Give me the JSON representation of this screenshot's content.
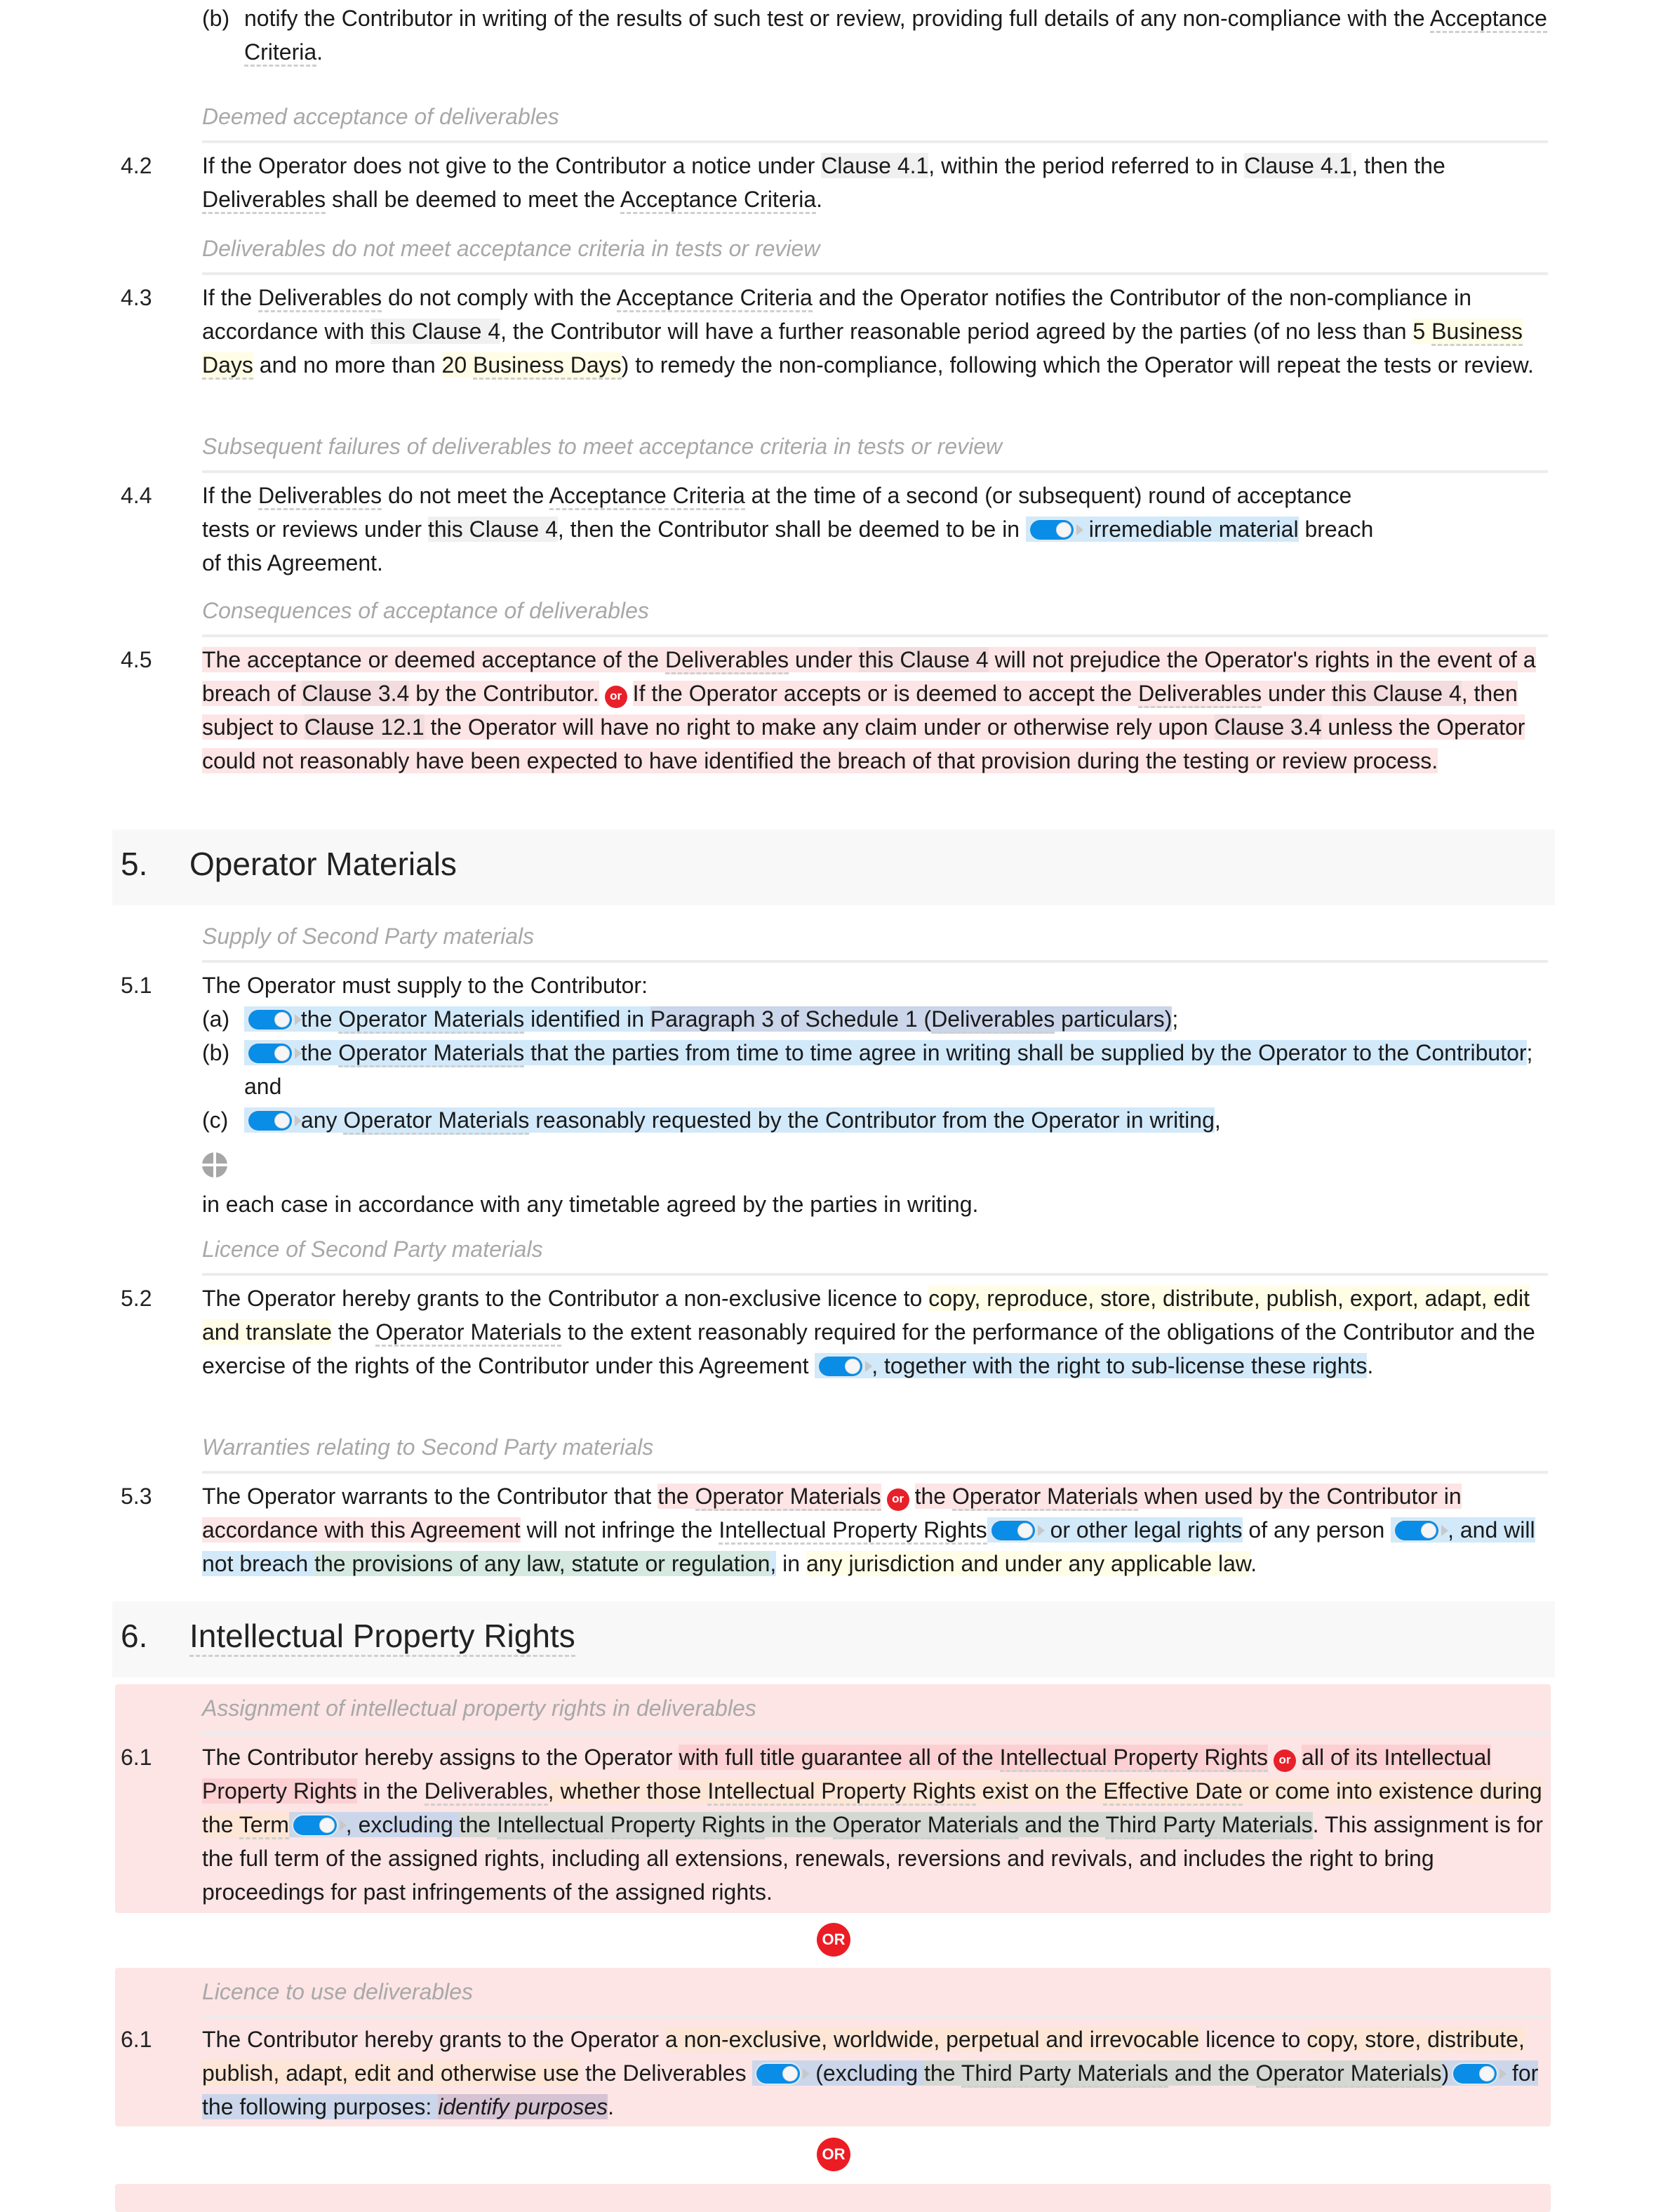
{
  "document": {
    "para_4_1_b": {
      "label": "(b)",
      "segments": [
        {
          "t": "notify the Contributor in writing of the results of such test or review, providing full details of any non-compliance with the "
        },
        {
          "t": "Acceptance Criteria",
          "k": "dterm"
        },
        {
          "t": "."
        }
      ]
    },
    "caption_4_2": "Deemed acceptance of deliverables",
    "para_4_2": {
      "num": "4.2",
      "segments": [
        {
          "t": "If the Operator does not give to the Contributor a notice under "
        },
        {
          "t": "Clause 4.1",
          "k": "cref"
        },
        {
          "t": ", within the period referred to in "
        },
        {
          "t": "Clause 4.1",
          "k": "cref"
        },
        {
          "t": ", then the "
        },
        {
          "t": "Deliverables",
          "k": "dterm"
        },
        {
          "t": " shall be deemed to meet the "
        },
        {
          "t": "Acceptance Criteria",
          "k": "dterm"
        },
        {
          "t": "."
        }
      ]
    },
    "caption_4_3": "Deliverables do not meet acceptance criteria in tests or review",
    "para_4_3": {
      "num": "4.3",
      "segments": [
        {
          "t": "If the "
        },
        {
          "t": "Deliverables",
          "k": "dterm"
        },
        {
          "t": " do not comply with the "
        },
        {
          "t": "Acceptance Criteria",
          "k": "dterm"
        },
        {
          "t": " and the Operator notifies the Contributor of the non-compliance in accordance with "
        },
        {
          "t": "this Clause 4",
          "k": "cref"
        },
        {
          "t": ", the Contributor will have a further reasonable period agreed by the parties (of no less than "
        },
        {
          "t": "5 ",
          "k": "hl-yellow"
        },
        {
          "t": "Business Days",
          "k": "hl-yellow dterm"
        },
        {
          "t": " and no more than "
        },
        {
          "t": "20 ",
          "k": "hl-yellow"
        },
        {
          "t": "Business Days",
          "k": "hl-yellow dterm"
        },
        {
          "t": ") to remedy the non-compliance, following which the Operator will repeat the tests or review."
        }
      ]
    },
    "caption_4_4": "Subsequent failures of deliverables to meet acceptance criteria in tests or review",
    "para_4_4": {
      "num": "4.4",
      "segments": [
        {
          "t": "If the "
        },
        {
          "t": "Deliverables",
          "k": "dterm"
        },
        {
          "t": " do not meet the "
        },
        {
          "t": "Acceptance Criteria",
          "k": "dterm"
        },
        {
          "t": " at the time of a second (or subsequent) round of acceptance tests or reviews under "
        },
        {
          "t": "this Clause 4",
          "k": "cref"
        },
        {
          "t": ", then the Contributor shall be deemed to be in "
        },
        {
          "toggle": true,
          "k": "hl-blue"
        },
        {
          "t": " irremediable material",
          "k": "hl-blue"
        },
        {
          "t": " breach of this Agreement."
        }
      ]
    },
    "caption_4_5": "Consequences of acceptance of deliverables",
    "para_4_5": {
      "num": "4.5",
      "segments": [
        {
          "t": "The acceptance or deemed acceptance of the ",
          "k": "hl-pink"
        },
        {
          "t": "Deliverables",
          "k": "hl-pink dterm"
        },
        {
          "t": " under ",
          "k": "hl-pink"
        },
        {
          "t": "this Clause 4",
          "k": "hl-pinkcref"
        },
        {
          "t": " will not prejudice the Operator's rights in the event of a breach of ",
          "k": "hl-pink"
        },
        {
          "t": "Clause 3.4",
          "k": "hl-pinkcref"
        },
        {
          "t": " by the Contributor.",
          "k": "hl-pink"
        },
        {
          "or": "or"
        },
        {
          "t": "If the Operator accepts or is deemed to accept the ",
          "k": "hl-pink"
        },
        {
          "t": "Deliverables",
          "k": "hl-pink dterm"
        },
        {
          "t": " under ",
          "k": "hl-pink"
        },
        {
          "t": "this Clause 4",
          "k": "hl-pinkcref"
        },
        {
          "t": ", then subject to ",
          "k": "hl-pink"
        },
        {
          "t": "Clause 12.1",
          "k": "hl-pinkcref"
        },
        {
          "t": " the Operator will have no right to make any claim under or otherwise rely upon ",
          "k": "hl-pink"
        },
        {
          "t": "Clause 3.4",
          "k": "hl-pinkcref"
        },
        {
          "t": " unless the Operator could not reasonably have been expected to have identified the breach of that provision during the testing or review process.",
          "k": "hl-pink"
        }
      ]
    },
    "section_5": {
      "num": "5.",
      "title": "Operator Materials"
    },
    "caption_5_1": "Supply of Second Party materials",
    "para_5_1": {
      "num": "5.1",
      "intro": "The Operator must supply to the Contributor:",
      "items": [
        {
          "label": "(a)",
          "segments": [
            {
              "toggle": true,
              "k": "hl-blue"
            },
            {
              "t": "the ",
              "k": "hl-blue"
            },
            {
              "t": "Operator Materials",
              "k": "hl-blue dterm"
            },
            {
              "t": " identified in ",
              "k": "hl-blue"
            },
            {
              "t": "Paragraph 3 of Schedule 1 (",
              "k": "hl-blue2"
            },
            {
              "t": "Deliverables",
              "k": "hl-blue2 dterm"
            },
            {
              "t": " particulars)",
              "k": "hl-blue2"
            },
            {
              "t": ";"
            }
          ]
        },
        {
          "label": "(b)",
          "segments": [
            {
              "toggle": true,
              "k": "hl-blue"
            },
            {
              "t": "the ",
              "k": "hl-blue"
            },
            {
              "t": "Operator Materials",
              "k": "hl-blue dterm"
            },
            {
              "t": " that the parties from time to time agree in writing shall be supplied by the Operator to the Contributor",
              "k": "hl-blue"
            },
            {
              "t": "; and"
            }
          ]
        },
        {
          "label": "(c)",
          "segments": [
            {
              "toggle": true,
              "k": "hl-blue"
            },
            {
              "t": "any ",
              "k": "hl-blue"
            },
            {
              "t": "Operator Materials",
              "k": "hl-blue dterm"
            },
            {
              "t": " reasonably requested by the Contributor from the Operator in writing",
              "k": "hl-blue"
            },
            {
              "t": ","
            }
          ]
        }
      ],
      "add_icon": "add-item-icon",
      "outro": "in each case in accordance with any timetable agreed by the parties in writing."
    },
    "caption_5_2": "Licence of Second Party materials",
    "para_5_2": {
      "num": "5.2",
      "segments": [
        {
          "t": "The Operator hereby grants to the Contributor a non-exclusive licence to "
        },
        {
          "t": "copy, reproduce, store, distribute, publish, export, adapt, edit and translate",
          "k": "hl-yellow"
        },
        {
          "t": " the "
        },
        {
          "t": "Operator Materials",
          "k": "dterm"
        },
        {
          "t": " to the extent reasonably required for the performance of the obligations of the Contributor and the exercise of the rights of the Contributor under this Agreement "
        },
        {
          "toggle": true,
          "k": "hl-blue"
        },
        {
          "t": ", together with the right to sub-license these rights",
          "k": "hl-blue"
        },
        {
          "t": "."
        }
      ]
    },
    "caption_5_3": "Warranties relating to Second Party materials",
    "para_5_3": {
      "num": "5.3",
      "segments": [
        {
          "t": "The Operator warrants to the Contributor that "
        },
        {
          "t": "the ",
          "k": "hl-pink"
        },
        {
          "t": "Operator Materials",
          "k": "hl-pink dterm"
        },
        {
          "or": "or"
        },
        {
          "t": "the ",
          "k": "hl-pink"
        },
        {
          "t": "Operator Materials",
          "k": "hl-pink dterm"
        },
        {
          "t": " when used by the Contributor in accordance with this Agreement",
          "k": "hl-pink"
        },
        {
          "t": " will not infringe the "
        },
        {
          "t": "Intellectual Property Rights",
          "k": "dterm"
        },
        {
          "toggle": true,
          "k": "hl-blue"
        },
        {
          "t": " or other legal rights",
          "k": "hl-blue"
        },
        {
          "t": " of any person "
        },
        {
          "toggle": true,
          "k": "hl-blue"
        },
        {
          "t": ", and will not breach ",
          "k": "hl-blue"
        },
        {
          "t": "the provisions of any law, statute or regulation",
          "k": "hl-green"
        },
        {
          "t": ",",
          "k": "hl-blue"
        },
        {
          "t": " in "
        },
        {
          "t": "any jurisdiction and under any applicable law",
          "k": "hl-yellow"
        },
        {
          "t": "."
        }
      ]
    },
    "section_6": {
      "num": "6.",
      "title": "Intellectual Property Rights"
    },
    "option_1": {
      "caption": "Assignment of intellectual property rights in deliverables",
      "num": "6.1",
      "segments": [
        {
          "t": "The Contributor hereby assigns to the Operator "
        },
        {
          "t": "with full title guarantee all of the ",
          "k": "hl-pink2"
        },
        {
          "t": "Intellectual Property Rights",
          "k": "hl-pink2 dterm"
        },
        {
          "or": "or"
        },
        {
          "t": "all of its ",
          "k": "hl-pink2"
        },
        {
          "t": "Intellectual Property Rights",
          "k": "hl-pink2"
        },
        {
          "t": " in the "
        },
        {
          "t": "Deliverables",
          "k": "dterm"
        },
        {
          "t": ", whether those ",
          "k": "hl-orange"
        },
        {
          "t": "Intellectual Property Rights",
          "k": "hl-orange dterm"
        },
        {
          "t": " exist on the ",
          "k": "hl-orange"
        },
        {
          "t": "Effective Date",
          "k": "hl-orange dterm"
        },
        {
          "t": " or come into existence during the ",
          "k": "hl-orange"
        },
        {
          "t": "Term",
          "k": "hl-orange dterm"
        },
        {
          "toggle": true,
          "k": "hl-blue2"
        },
        {
          "t": ", excluding ",
          "k": "hl-blue2"
        },
        {
          "t": "the ",
          "k": "hl-grey"
        },
        {
          "t": "Intellectual Property Rights",
          "k": "hl-grey dterm"
        },
        {
          "t": " in the ",
          "k": "hl-grey"
        },
        {
          "t": "Operator Materials",
          "k": "hl-grey dterm"
        },
        {
          "t": " and the ",
          "k": "hl-grey"
        },
        {
          "t": "Third Party Materials",
          "k": "hl-grey dterm"
        },
        {
          "t": ". This assignment is for the full term of the assigned rights, including all extensions, renewals, reversions and revivals, and includes the right to bring proceedings for past infringements of the assigned rights."
        }
      ]
    },
    "or_divider_1": "OR",
    "option_2": {
      "caption": "Licence to use deliverables",
      "num": "6.1",
      "segments": [
        {
          "t": "The Contributor hereby grants to the Operator "
        },
        {
          "t": "a non-exclusive, worldwide, perpetual and irrevocable",
          "k": "hl-orange"
        },
        {
          "t": " licence to "
        },
        {
          "t": "copy, store, distribute, publish, adapt, edit and otherwise use",
          "k": "hl-orange"
        },
        {
          "t": " the Deliverables "
        },
        {
          "toggle": true,
          "k": "hl-blue2"
        },
        {
          "t": " (excluding ",
          "k": "hl-blue2"
        },
        {
          "t": "the ",
          "k": "hl-grey"
        },
        {
          "t": "Third Party Materials",
          "k": "hl-grey dterm"
        },
        {
          "t": " and the ",
          "k": "hl-grey"
        },
        {
          "t": "Operator Materials",
          "k": "hl-grey dterm"
        },
        {
          "t": ")",
          "k": "hl-blue2"
        },
        {
          "toggle": true,
          "k": "hl-blue2"
        },
        {
          "t": " for the following purposes: ",
          "k": "hl-blue2"
        },
        {
          "t": "identify purposes",
          "k": "hl-purple it"
        },
        {
          "t": "."
        }
      ]
    },
    "or_divider_2": "OR"
  }
}
